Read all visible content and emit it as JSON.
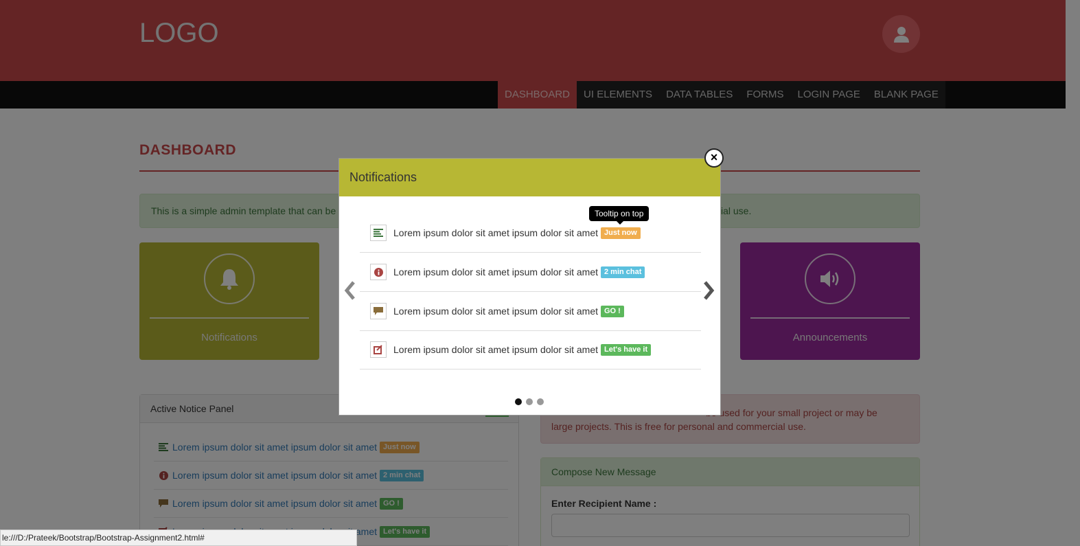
{
  "header": {
    "logo": "LOGO",
    "avatar_icon": "user-icon"
  },
  "nav": {
    "items": [
      {
        "label": "DASHBOARD",
        "active": true
      },
      {
        "label": "UI ELEMENTS"
      },
      {
        "label": "DATA TABLES"
      },
      {
        "label": "FORMS"
      },
      {
        "label": "LOGIN PAGE"
      },
      {
        "label": "BLANK PAGE"
      }
    ]
  },
  "page": {
    "title": "DASHBOARD",
    "info_alert_start": "This is a simple admin template that can be u",
    "info_alert_end": "ial use."
  },
  "tiles": {
    "notifications": {
      "label": "Notifications",
      "icon": "bell-icon",
      "color": "#b7b734"
    },
    "announcements": {
      "label": "Announcements",
      "icon": "volume-icon",
      "color": "#9b2a9e"
    }
  },
  "notice_panel": {
    "title": "Active Notice Panel",
    "items": [
      {
        "text": "Lorem ipsum dolor sit amet ipsum dolor sit amet",
        "badge": "Just now",
        "icon": "align-left-icon"
      },
      {
        "text": "Lorem ipsum dolor sit amet ipsum dolor sit amet",
        "badge": "2 min chat",
        "icon": "info-icon"
      },
      {
        "text": "Lorem ipsum dolor sit amet ipsum dolor sit amet",
        "badge": "GO !",
        "icon": "comment-icon"
      },
      {
        "text": "Lorem ipsum dolor sit amet ipsum dolor sit amet",
        "badge": "Let's have it",
        "icon": "edit-icon"
      }
    ]
  },
  "danger_alert": {
    "line1": "be used for your small project or may be",
    "line2": "large projects. This is free for personal and commercial use."
  },
  "compose": {
    "title": "Compose New Message",
    "recipient_label": "Enter Recipient Name :",
    "recipient_value": ""
  },
  "modal": {
    "title": "Notifications",
    "close": "×",
    "tooltip": "Tooltip on top",
    "items": [
      {
        "text": "Lorem ipsum dolor sit amet ipsum dolor sit amet",
        "badge": "Just now",
        "icon": "align-left-icon"
      },
      {
        "text": "Lorem ipsum dolor sit amet ipsum dolor sit amet",
        "badge": "2 min chat",
        "icon": "info-icon"
      },
      {
        "text": "Lorem ipsum dolor sit amet ipsum dolor sit amet",
        "badge": "GO !",
        "icon": "comment-icon"
      },
      {
        "text": "Lorem ipsum dolor sit amet ipsum dolor sit amet",
        "badge": "Let's have it",
        "icon": "edit-icon"
      }
    ],
    "carousel_pages": 3,
    "carousel_active": 1
  },
  "statusbar": {
    "url": "le:///D:/Prateek/Bootstrap/Bootstrap-Assignment2.html#"
  },
  "colors": {
    "brand": "#c9494b",
    "modal_head": "#b7b734",
    "warning": "#f0ad4e",
    "info": "#5bc0de",
    "success": "#5cb85c"
  }
}
